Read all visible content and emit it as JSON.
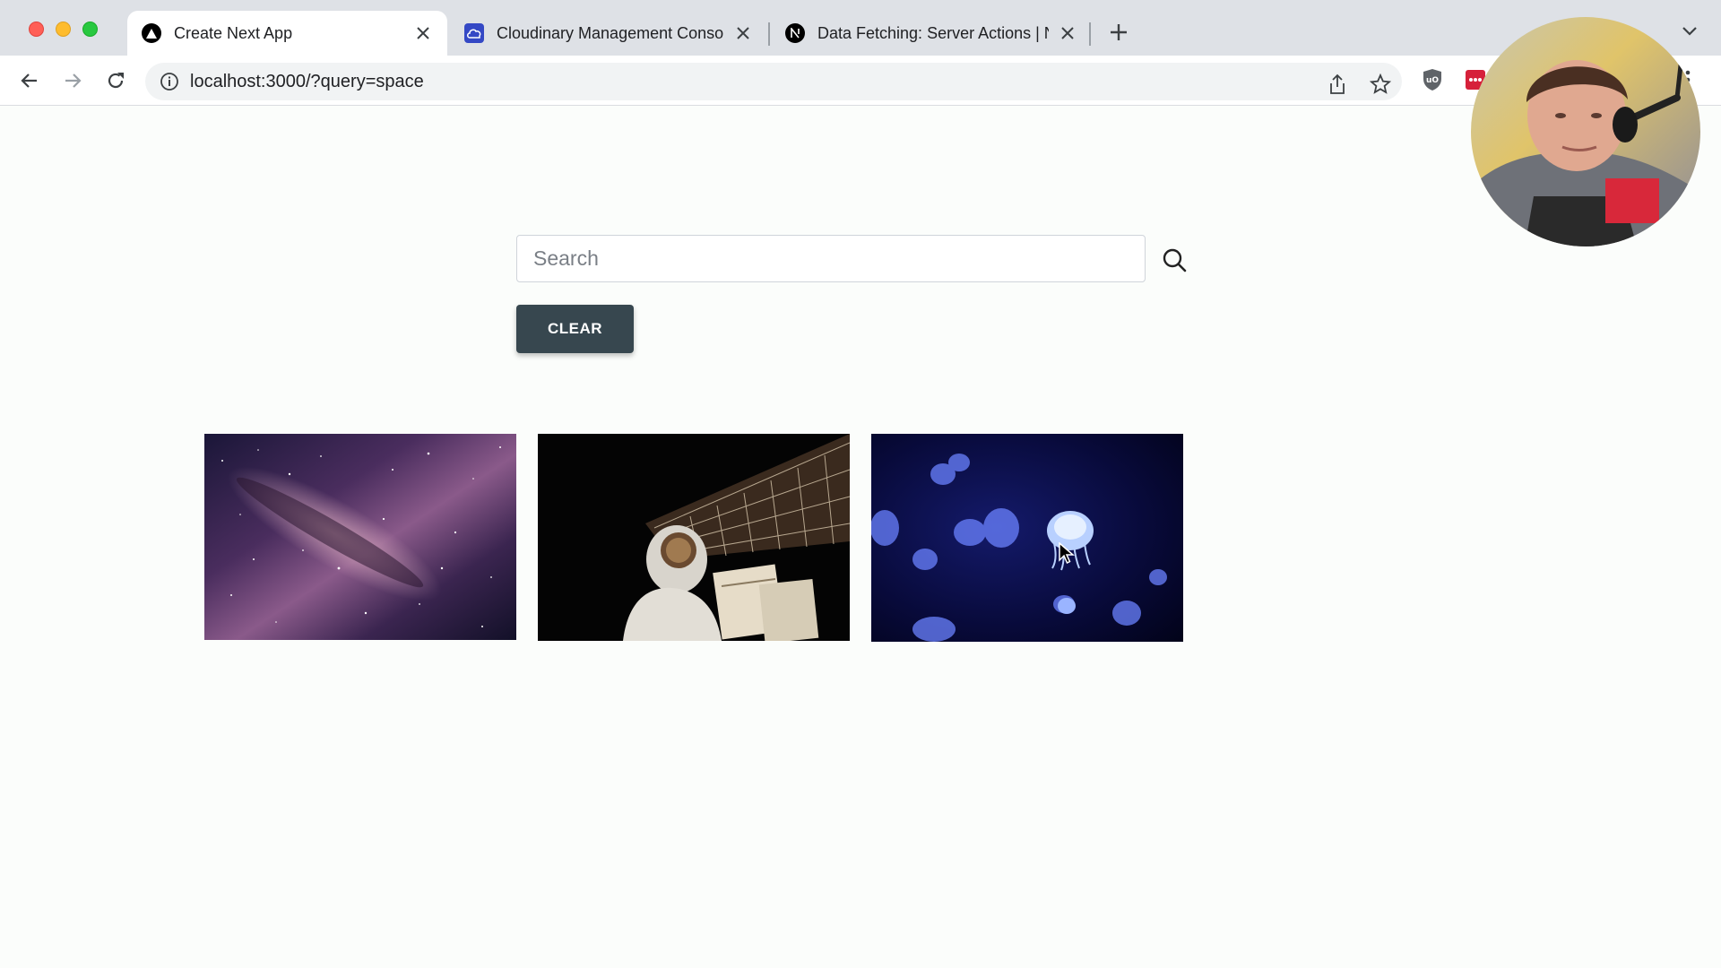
{
  "browser": {
    "tabs": [
      {
        "title": "Create Next App",
        "active": true,
        "favicon": "triangle-icon"
      },
      {
        "title": "Cloudinary Management Console",
        "active": false,
        "favicon": "cloudinary-icon"
      },
      {
        "title": "Data Fetching: Server Actions | Next.js",
        "active": false,
        "favicon": "nextjs-icon"
      }
    ],
    "url": "localhost:3000/?query=space"
  },
  "page": {
    "search": {
      "placeholder": "Search",
      "value": ""
    },
    "clear_label": "CLEAR",
    "images": [
      {
        "subject": "milky-way-galaxy"
      },
      {
        "subject": "astronaut-spacewalk"
      },
      {
        "subject": "jellyfish"
      }
    ]
  },
  "colors": {
    "button_bg": "#37474f",
    "page_bg": "#fbfdfb",
    "tab_strip": "#dee1e6"
  }
}
